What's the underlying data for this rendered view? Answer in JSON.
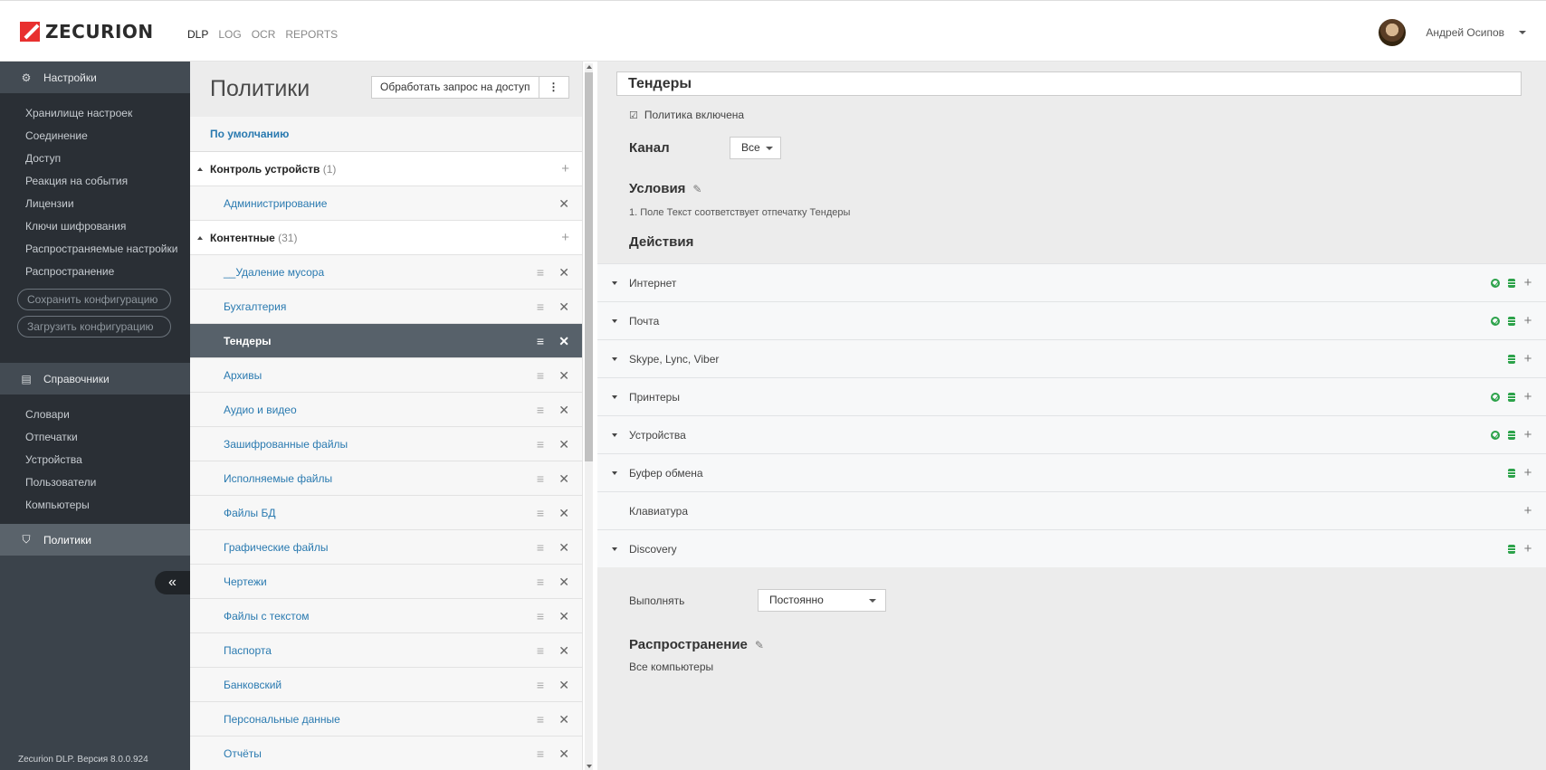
{
  "header": {
    "logo_text": "ZECURION",
    "nav": [
      "DLP",
      "LOG",
      "OCR",
      "REPORTS"
    ],
    "user_name": "Андрей Осипов"
  },
  "sidebar": {
    "settings_title": "Настройки",
    "settings_items": [
      "Хранилище настроек",
      "Соединение",
      "Доступ",
      "Реакция на события",
      "Лицензии",
      "Ключи шифрования",
      "Распространяемые настройки",
      "Распространение"
    ],
    "save_button": "Сохранить конфигурацию",
    "load_button": "Загрузить конфигурацию",
    "directories_title": "Справочники",
    "directories_items": [
      "Словари",
      "Отпечатки",
      "Устройства",
      "Пользователи",
      "Компьютеры"
    ],
    "policies_title": "Политики",
    "collapse_label": "«",
    "version": "Zecurion DLP. Версия 8.0.0.924"
  },
  "policies": {
    "title": "Политики",
    "action_button": "Обработать запрос на доступ",
    "menu_label": "⋮",
    "default_link": "По умолчанию",
    "groups": [
      {
        "name": "Контроль устройств",
        "count": "(1)",
        "items": [
          "Администрирование"
        ]
      },
      {
        "name": "Контентные",
        "count": "(31)",
        "items": [
          "__Удаление мусора",
          "Бухгалтерия",
          "Тендеры",
          "Архивы",
          "Аудио и видео",
          "Зашифрованные файлы",
          "Исполняемые файлы",
          "Файлы БД",
          "Графические файлы",
          "Чертежи",
          "Файлы с текстом",
          "Паспорта",
          "Банковский",
          "Персональные данные",
          "Отчёты"
        ]
      }
    ],
    "selected": "Тендеры"
  },
  "detail": {
    "policy_name": "Тендеры",
    "enabled_label": "Политика включена",
    "channel_label": "Канал",
    "channel_value": "Все",
    "conditions_label": "Условия",
    "condition_text": "1. Поле Текст соответствует отпечатку Тендеры",
    "actions_label": "Действия",
    "channels": [
      {
        "name": "Интернет",
        "ok": true,
        "db": true,
        "expand": true
      },
      {
        "name": "Почта",
        "ok": true,
        "db": true,
        "expand": true
      },
      {
        "name": "Skype, Lync, Viber",
        "ok": false,
        "db": true,
        "expand": true
      },
      {
        "name": "Принтеры",
        "ok": true,
        "db": true,
        "expand": true
      },
      {
        "name": "Устройства",
        "ok": true,
        "db": true,
        "expand": true
      },
      {
        "name": "Буфер обмена",
        "ok": false,
        "db": true,
        "expand": true
      },
      {
        "name": "Клавиатура",
        "ok": false,
        "db": false,
        "expand": false
      },
      {
        "name": "Discovery",
        "ok": false,
        "db": true,
        "expand": true
      }
    ],
    "execute_label": "Выполнять",
    "execute_value": "Постоянно",
    "distribution_label": "Распространение",
    "distribution_value": "Все компьютеры"
  },
  "colors": {
    "accent_red": "#e8302f",
    "link_blue": "#2a7ab0",
    "status_green": "#2ca24a",
    "sidebar_dark": "#2a2f35",
    "selected_row": "#57616a"
  }
}
